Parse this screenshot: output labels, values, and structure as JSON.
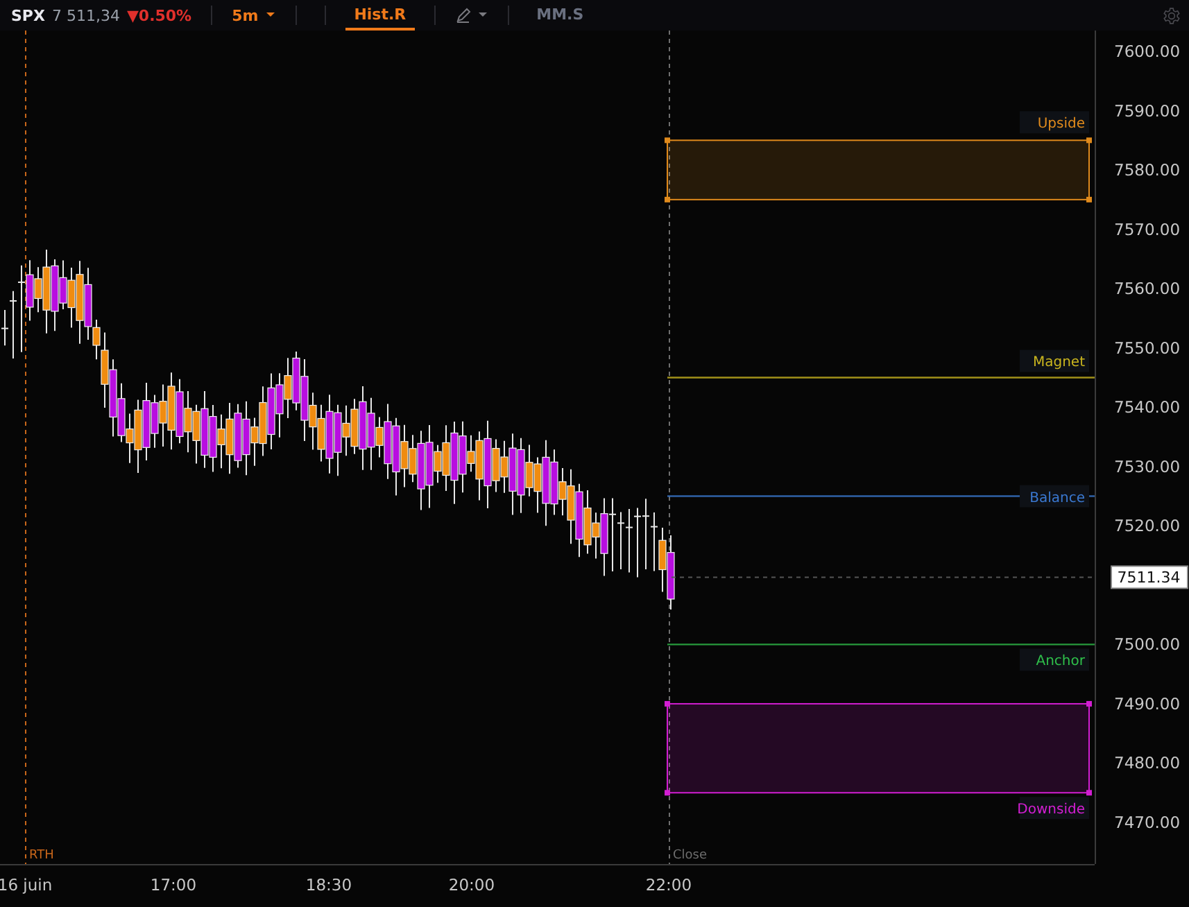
{
  "toolbar": {
    "symbol": "SPX",
    "price": "7 511,34",
    "change": "▼0.50%",
    "interval": "5m",
    "tabs": [
      {
        "label": "Hist.R",
        "selected": true
      },
      {
        "label": "MM.S",
        "selected": false
      }
    ]
  },
  "chart": {
    "y_axis_labels": [
      "7600.00",
      "7590.00",
      "7580.00",
      "7570.00",
      "7560.00",
      "7550.00",
      "7540.00",
      "7530.00",
      "7520.00",
      "7500.00",
      "7490.00",
      "7480.00",
      "7470.00"
    ],
    "x_axis_labels": [
      "16 juin",
      "17:00",
      "18:30",
      "20:00",
      "22:00"
    ],
    "session_markers": [
      {
        "label": "RTH",
        "color": "#c8661a"
      },
      {
        "label": "Close",
        "color": "#6e6e6e"
      }
    ],
    "levels": [
      {
        "kind": "band",
        "label": "Upside",
        "color": "#e08a1c"
      },
      {
        "kind": "line",
        "label": "Magnet",
        "color": "#c8b41e"
      },
      {
        "kind": "line",
        "label": "Balance",
        "color": "#3a78d0"
      },
      {
        "kind": "line",
        "label": "Anchor",
        "color": "#2fbf4a"
      },
      {
        "kind": "band",
        "label": "Downside",
        "color": "#d21ed2"
      }
    ],
    "last_price": "7511.34"
  }
}
